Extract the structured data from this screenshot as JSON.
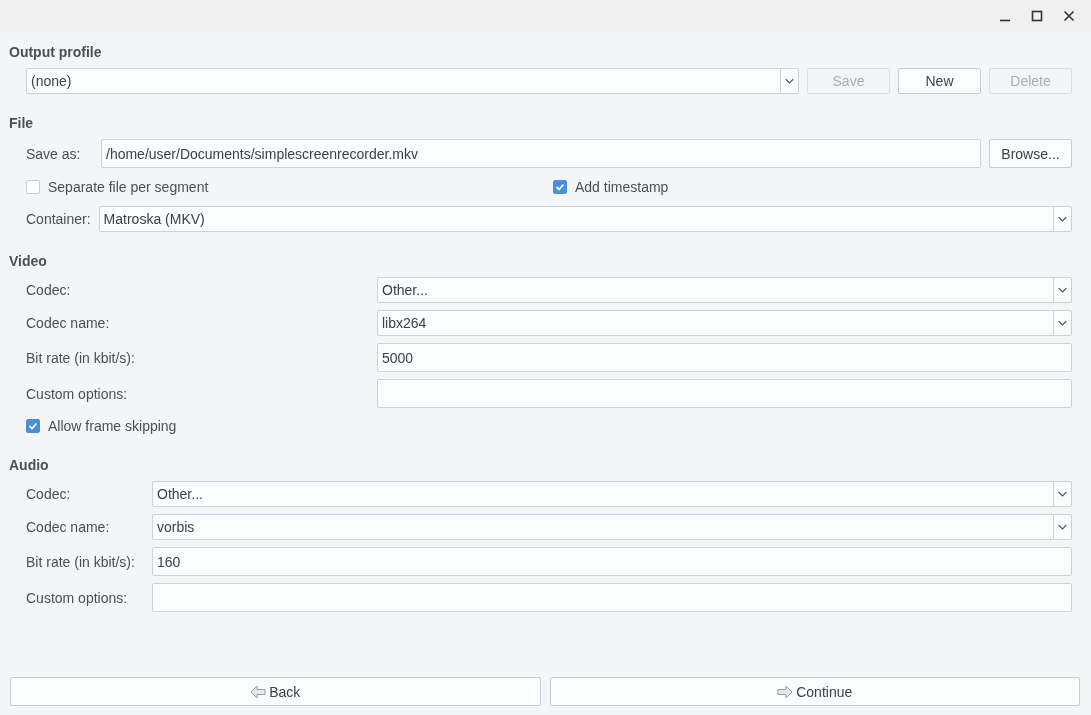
{
  "output_profile": {
    "title": "Output profile",
    "profile": {
      "value": "(none)"
    },
    "buttons": [
      {
        "label": "Save",
        "disabled": true
      },
      {
        "label": "New",
        "disabled": false
      },
      {
        "label": "Delete",
        "disabled": true
      }
    ]
  },
  "file": {
    "title": "File",
    "save_as": {
      "label": "Save as:",
      "value": "/home/user/Documents/simplescreenrecorder.mkv"
    },
    "browse_button": "Browse...",
    "checkboxes": [
      {
        "label": "Separate file per segment",
        "checked": false
      },
      {
        "label": "Add timestamp",
        "checked": true
      }
    ],
    "container": {
      "label": "Container:",
      "value": "Matroska (MKV)"
    }
  },
  "video": {
    "title": "Video",
    "fields": [
      {
        "kind": "combo",
        "label": "Codec:",
        "value": "Other..."
      },
      {
        "kind": "combo",
        "label": "Codec name:",
        "value": "libx264"
      },
      {
        "kind": "text",
        "label": "Bit rate (in kbit/s):",
        "value": "5000"
      },
      {
        "kind": "text",
        "label": "Custom options:"
      }
    ],
    "checkboxes": [
      {
        "label": "Allow frame skipping",
        "checked": true
      }
    ]
  },
  "audio": {
    "title": "Audio",
    "fields": [
      {
        "kind": "combo",
        "label": "Codec:",
        "value": "Other..."
      },
      {
        "kind": "combo",
        "label": "Codec name:",
        "value": "vorbis"
      },
      {
        "kind": "text",
        "label": "Bit rate (in kbit/s):",
        "value": "160"
      },
      {
        "kind": "text",
        "label": "Custom options:"
      }
    ]
  },
  "nav_buttons": [
    {
      "kind": "back",
      "label": "Back"
    },
    {
      "kind": "forward",
      "label": "Continue"
    }
  ]
}
